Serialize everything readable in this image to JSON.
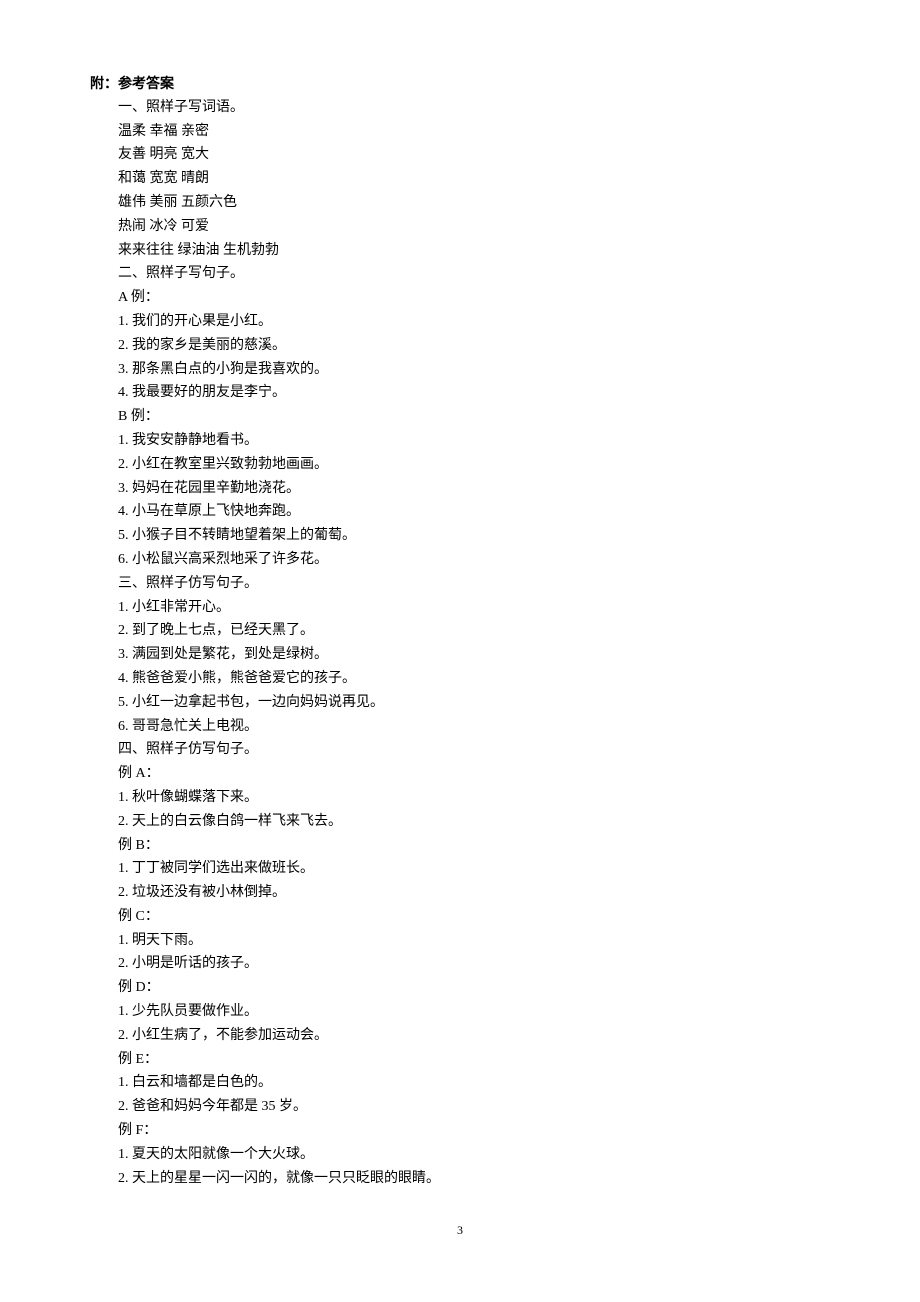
{
  "heading": "附：参考答案",
  "lines": [
    "一、照样子写词语。",
    "温柔 幸福 亲密",
    "友善 明亮 宽大",
    "和蔼 宽宽 晴朗",
    "雄伟 美丽 五颜六色",
    "热闹 冰冷 可爱",
    "来来往往 绿油油 生机勃勃",
    "二、照样子写句子。",
    "A 例：",
    "1. 我们的开心果是小红。",
    "2. 我的家乡是美丽的慈溪。",
    "3. 那条黑白点的小狗是我喜欢的。",
    "4. 我最要好的朋友是李宁。",
    "B 例：",
    "1. 我安安静静地看书。",
    "2. 小红在教室里兴致勃勃地画画。",
    "3. 妈妈在花园里辛勤地浇花。",
    "4. 小马在草原上飞快地奔跑。",
    "5. 小猴子目不转睛地望着架上的葡萄。",
    "6. 小松鼠兴高采烈地采了许多花。",
    "三、照样子仿写句子。",
    "1. 小红非常开心。",
    "2. 到了晚上七点，已经天黑了。",
    "3. 满园到处是繁花，到处是绿树。",
    "4.  熊爸爸爱小熊，熊爸爸爱它的孩子。",
    "5. 小红一边拿起书包，一边向妈妈说再见。",
    "6. 哥哥急忙关上电视。",
    "四、照样子仿写句子。",
    "例 A：",
    "1. 秋叶像蝴蝶落下来。",
    "2. 天上的白云像白鸽一样飞来飞去。",
    "例 B：",
    "1. 丁丁被同学们选出来做班长。",
    "2. 垃圾还没有被小林倒掉。",
    "例 C：",
    "1. 明天下雨。",
    "2. 小明是听话的孩子。",
    "例 D：",
    "1. 少先队员要做作业。",
    "2. 小红生病了，不能参加运动会。",
    "例 E：",
    "1. 白云和墙都是白色的。",
    "2. 爸爸和妈妈今年都是 35 岁。",
    "例 F：",
    "1. 夏天的太阳就像一个大火球。",
    "2. 天上的星星一闪一闪的，就像一只只眨眼的眼睛。"
  ],
  "pageNumber": "3"
}
